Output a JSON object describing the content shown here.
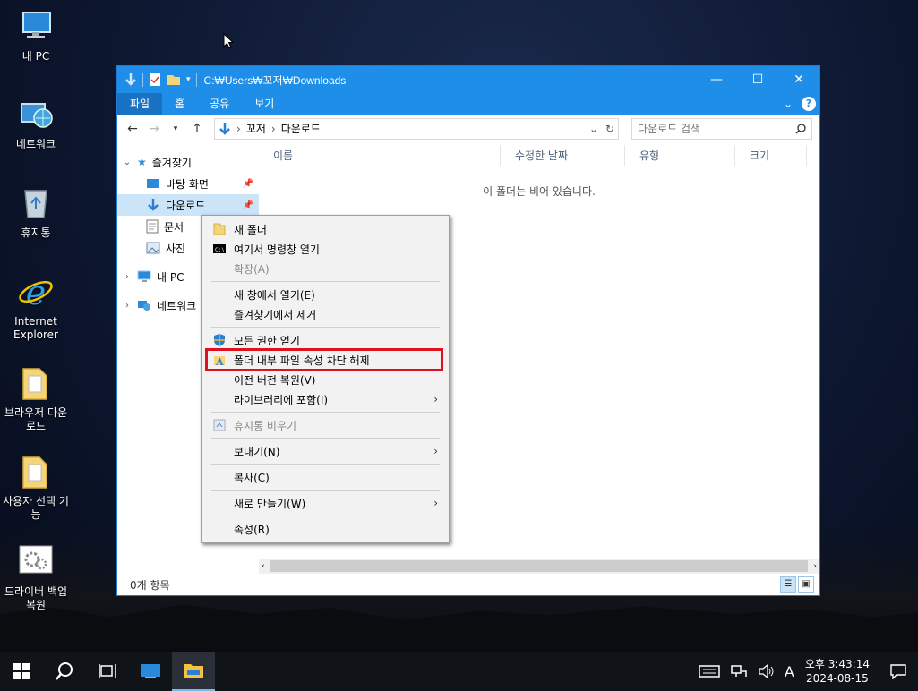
{
  "desktop": {
    "icons": [
      {
        "label": "내 PC",
        "icon": "computer-icon"
      },
      {
        "label": "네트워크",
        "icon": "network-icon"
      },
      {
        "label": "휴지통",
        "icon": "recycle-bin-icon"
      },
      {
        "label": "Internet Explorer",
        "icon": "internet-explorer-icon"
      },
      {
        "label": "브라우저 다운로드",
        "icon": "folder-icon"
      },
      {
        "label": "사용자 선택 기능",
        "icon": "folder-icon"
      },
      {
        "label": "드라이버 백업 복원",
        "icon": "gear-icon"
      }
    ]
  },
  "window": {
    "title": "C:₩Users₩꼬저₩Downloads",
    "controls": {
      "minimize": "—",
      "maximize": "☐",
      "close": "✕"
    },
    "ribbon_tabs": [
      "파일",
      "홈",
      "공유",
      "보기"
    ],
    "help": "?",
    "address": {
      "crumbs": [
        "꼬저",
        "다운로드"
      ],
      "search_placeholder": "다운로드 검색"
    },
    "nav": {
      "quick_access": "즐겨찾기",
      "items": [
        {
          "label": "바탕 화면",
          "icon": "desktop-icon",
          "pinned": true
        },
        {
          "label": "다운로드",
          "icon": "download-icon",
          "pinned": true
        },
        {
          "label": "문서",
          "icon": "document-icon",
          "pinned": false
        },
        {
          "label": "사진",
          "icon": "picture-icon",
          "pinned": false
        }
      ],
      "this_pc": "내 PC",
      "network": "네트워크"
    },
    "columns": [
      "이름",
      "수정한 날짜",
      "유형",
      "크기"
    ],
    "empty_message": "이 폴더는 비어 있습니다.",
    "status": "0개 항목"
  },
  "context_menu": {
    "items": [
      {
        "label": "새 폴더",
        "icon": "folder-icon",
        "disabled": false
      },
      {
        "label": "여기서 명령창 열기",
        "icon": "cmd-icon",
        "disabled": false
      },
      {
        "label": "확장(A)",
        "icon": "",
        "disabled": true
      },
      {
        "label": "새 창에서 열기(E)",
        "icon": "",
        "disabled": false
      },
      {
        "label": "즐겨찾기에서 제거",
        "icon": "",
        "disabled": false
      },
      {
        "label": "모든 권한 얻기",
        "icon": "shield-icon",
        "disabled": false
      },
      {
        "label": "폴더 내부 파일 속성 차단 해제",
        "icon": "unblock-icon",
        "disabled": false,
        "highlighted": true
      },
      {
        "label": "이전 버전 복원(V)",
        "icon": "",
        "disabled": false
      },
      {
        "label": "라이브러리에 포함(I)",
        "icon": "",
        "disabled": false,
        "submenu": true
      },
      {
        "label": "휴지통 비우기",
        "icon": "recycle-bin-icon",
        "disabled": true
      },
      {
        "label": "보내기(N)",
        "icon": "",
        "disabled": false,
        "submenu": true
      },
      {
        "label": "복사(C)",
        "icon": "",
        "disabled": false
      },
      {
        "label": "새로 만들기(W)",
        "icon": "",
        "disabled": false,
        "submenu": true
      },
      {
        "label": "속성(R)",
        "icon": "",
        "disabled": false
      }
    ],
    "highlight_color": "#e0101e"
  },
  "taskbar": {
    "clock": {
      "time": "오후 3:43:14",
      "date": "2024-08-15"
    },
    "ime": "A"
  }
}
